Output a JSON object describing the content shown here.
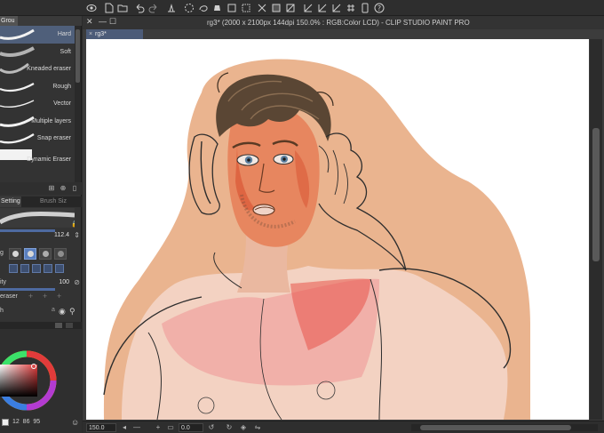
{
  "window": {
    "title": "rg3* (2000 x 2100px 144dpi 150.0% : RGB:Color LCD) - CLIP STUDIO PAINT PRO",
    "document_tab": "rg3*"
  },
  "toolbar": {
    "icons": [
      "app-menu-icon",
      "new-file-icon",
      "open-file-icon",
      "save-icon",
      "undo-icon",
      "redo-icon",
      "clear-icon",
      "transform-icon",
      "marquee-icon",
      "lasso-icon",
      "fill-icon",
      "brush-icon",
      "select-all-icon",
      "deselect-icon",
      "crop-icon",
      "invert-icon",
      "line-icon",
      "ruler-icon",
      "snap-icon",
      "snap-grid-icon",
      "phone-icon",
      "help-icon"
    ]
  },
  "subtool_panel": {
    "group_tab": "Grou",
    "brushes": [
      {
        "label": "Hard",
        "selected": true
      },
      {
        "label": "Soft",
        "selected": false
      },
      {
        "label": "Kneaded eraser",
        "selected": false
      },
      {
        "label": "Rough",
        "selected": false
      },
      {
        "label": "Vector",
        "selected": false
      },
      {
        "label": "Multiple layers",
        "selected": false
      },
      {
        "label": "Snap eraser",
        "selected": false
      },
      {
        "label": "Dynamic Eraser",
        "selected": false
      }
    ]
  },
  "tool_property": {
    "tab_settings": "Setting",
    "tab_brush_size": "Brush Siz",
    "size_value": "112.4",
    "tip_shape_label": "g",
    "density_label": "ity",
    "density_value": "100",
    "eraser_label": "eraser",
    "extra_label": "h"
  },
  "color": {
    "main_color": "#ffffff",
    "wheel_hue_color": "#e13b3b",
    "rgb_readout": "12  86  95"
  },
  "status": {
    "zoom": "150.0",
    "rotation": "0.0"
  },
  "colors": {
    "accent": "#4f5f7a",
    "background_skin": "#eab48f",
    "blush": "#e8534a"
  }
}
